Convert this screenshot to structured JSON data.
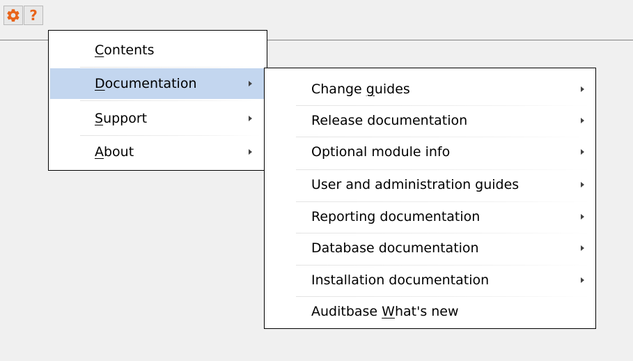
{
  "toolbar": {
    "settings_icon": "gear-icon",
    "help_icon": "question-mark-icon",
    "help_glyph": "?",
    "accent_color": "#e8641b"
  },
  "menu": {
    "items": [
      {
        "label": "Contents",
        "mnemonic": "C",
        "has_submenu": false,
        "highlighted": false
      },
      {
        "label": "Documentation",
        "mnemonic": "D",
        "has_submenu": true,
        "highlighted": true
      },
      {
        "label": "Support",
        "mnemonic": "S",
        "has_submenu": true,
        "highlighted": false
      },
      {
        "label": "About",
        "mnemonic": "A",
        "has_submenu": true,
        "highlighted": false
      }
    ],
    "highlight_color": "#c3d6ef"
  },
  "submenu": {
    "items": [
      {
        "label": "Change guides",
        "mnemonic": "g",
        "has_submenu": true
      },
      {
        "label": "Release documentation",
        "mnemonic": "",
        "has_submenu": true
      },
      {
        "label": "Optional module info",
        "mnemonic": "",
        "has_submenu": true
      },
      {
        "label": "User and administration guides",
        "mnemonic": "",
        "has_submenu": true
      },
      {
        "label": "Reporting documentation",
        "mnemonic": "",
        "has_submenu": true
      },
      {
        "label": "Database documentation",
        "mnemonic": "",
        "has_submenu": true
      },
      {
        "label": "Installation documentation",
        "mnemonic": "",
        "has_submenu": true
      },
      {
        "label": "Auditbase What's new",
        "mnemonic": "W",
        "has_submenu": false
      }
    ]
  }
}
